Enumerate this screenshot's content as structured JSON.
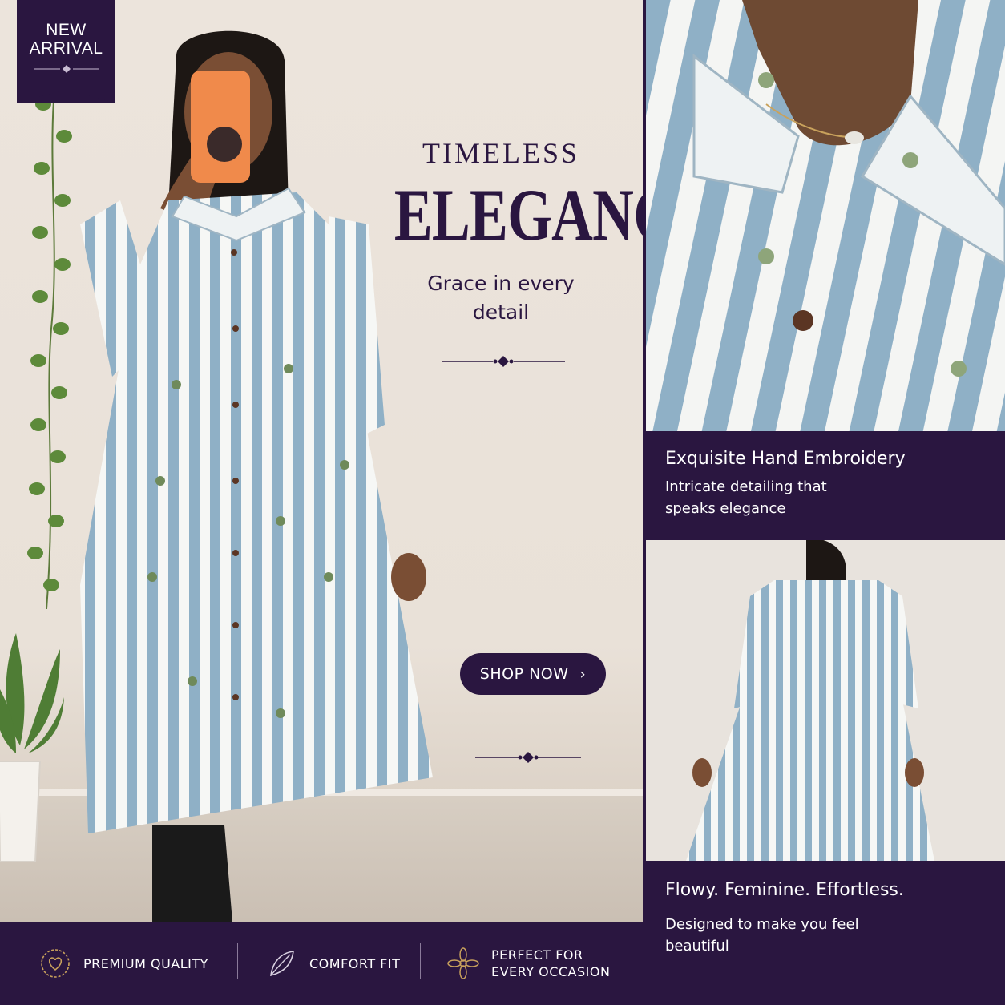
{
  "badge": {
    "line1": "NEW",
    "line2": "ARRIVAL"
  },
  "hero": {
    "headline_small": "TIMELESS",
    "headline_big": "ELEGANCE",
    "subline": "Grace in every detail",
    "cta_label": "SHOP NOW",
    "cta_icon": "chevron-right-icon"
  },
  "cards": [
    {
      "title": "Exquisite Hand Embroidery",
      "body": "Intricate detailing that speaks elegance"
    },
    {
      "title": "Flowy. Feminine. Effortless.",
      "body": "Designed to make you feel beautiful"
    }
  ],
  "features": [
    {
      "icon": "heart-badge-icon",
      "label": "PREMIUM QUALITY"
    },
    {
      "icon": "leaf-icon",
      "label": "COMFORT FIT"
    },
    {
      "icon": "flower-icon",
      "label": "PERFECT FOR EVERY OCCASION"
    }
  ],
  "colors": {
    "brand": "#2a1640",
    "accent_gold": "#c9a25c",
    "stripe_blue": "#8fb0c6",
    "background": "#ece4dc"
  }
}
